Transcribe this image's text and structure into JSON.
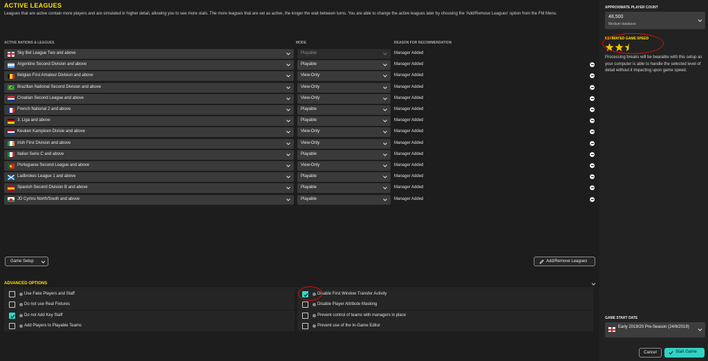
{
  "header": {
    "title": "ACTIVE LEAGUES",
    "intro": "Leagues that are active contain more players and are simulated in higher detail, allowing you to see more stats. The more leagues that are set as active, the longer the wait between turns. You are able to change the active leagues later by choosing the 'Add/Remove Leagues' option from the FM Menu."
  },
  "columns": {
    "nations": "ACTIVE NATIONS & LEAGUES",
    "mode": "MODE",
    "reason": "REASON FOR RECOMMENDATION"
  },
  "leagues": [
    {
      "name": "Sky Bet League Two and above",
      "mode": "Playable",
      "reason": "Manager Added",
      "flag": "england",
      "removable": false,
      "mode_dim": true
    },
    {
      "name": "Argentine Second Division and above",
      "mode": "Playable",
      "reason": "Manager Added",
      "flag": "argentina",
      "removable": true,
      "mode_dim": false
    },
    {
      "name": "Belgian First Amateur Division and above",
      "mode": "View-Only",
      "reason": "Manager Added",
      "flag": "belgium",
      "removable": true,
      "mode_dim": false
    },
    {
      "name": "Brazilian National Second Division and above",
      "mode": "View-Only",
      "reason": "Manager Added",
      "flag": "brazil",
      "removable": true,
      "mode_dim": false
    },
    {
      "name": "Croatian Second League and above",
      "mode": "View-Only",
      "reason": "Manager Added",
      "flag": "croatia",
      "removable": true,
      "mode_dim": false
    },
    {
      "name": "French National 2 and above",
      "mode": "Playable",
      "reason": "Manager Added",
      "flag": "france",
      "removable": true,
      "mode_dim": false
    },
    {
      "name": "3. Liga and above",
      "mode": "Playable",
      "reason": "Manager Added",
      "flag": "germany",
      "removable": true,
      "mode_dim": false
    },
    {
      "name": "Keuken Kampioen Divisie and above",
      "mode": "View-Only",
      "reason": "Manager Added",
      "flag": "netherlands",
      "removable": true,
      "mode_dim": false
    },
    {
      "name": "Irish First Division and above",
      "mode": "View-Only",
      "reason": "Manager Added",
      "flag": "ireland",
      "removable": true,
      "mode_dim": false
    },
    {
      "name": "Italian Serie C and above",
      "mode": "Playable",
      "reason": "Manager Added",
      "flag": "italy",
      "removable": true,
      "mode_dim": false
    },
    {
      "name": "Portuguese Second League and above",
      "mode": "View-Only",
      "reason": "Manager Added",
      "flag": "portugal",
      "removable": true,
      "mode_dim": false
    },
    {
      "name": "Ladbrokes League 1 and above",
      "mode": "Playable",
      "reason": "Manager Added",
      "flag": "scotland",
      "removable": true,
      "mode_dim": false
    },
    {
      "name": "Spanish Second Division B and above",
      "mode": "Playable",
      "reason": "Manager Added",
      "flag": "spain",
      "removable": true,
      "mode_dim": false
    },
    {
      "name": "JD Cymru North/South and above",
      "mode": "Playable",
      "reason": "Manager Added",
      "flag": "wales",
      "removable": true,
      "mode_dim": false
    }
  ],
  "buttons": {
    "game_setup": "Game Setup",
    "add_remove": "Add/Remove Leagues",
    "cancel": "Cancel",
    "start": "Start Game"
  },
  "advanced": {
    "title": "ADVANCED OPTIONS",
    "left": [
      {
        "label": "Use Fake Players and Staff",
        "checked": false
      },
      {
        "label": "Do not use Real Fixtures",
        "checked": false
      },
      {
        "label": "Do not Add Key Staff",
        "checked": true
      },
      {
        "label": "Add Players to Playable Teams",
        "checked": false
      }
    ],
    "right": [
      {
        "label": "Disable First Window Transfer Activity",
        "checked": true
      },
      {
        "label": "Disable Player Attribute Masking",
        "checked": false
      },
      {
        "label": "Prevent control of teams with managers in place",
        "checked": false
      },
      {
        "label": "Prevent use of the In-Game Editor",
        "checked": false
      }
    ]
  },
  "sidebar": {
    "player_count_label": "APPROXIMATE PLAYER COUNT",
    "player_count": "48,500",
    "database": "Medium database",
    "speed_label": "ESTIMATED GAME SPEED",
    "speed_stars": 2.5,
    "speed_max": 3,
    "speed_text": "Processing breaks will be bearable with this setup as your computer is able to handle the selected level of detail without it impacting upon game speed.",
    "start_date_label": "GAME START DATE",
    "start_date": "Early 2019/20 Pre-Season (24/6/2019)"
  },
  "colors": {
    "accent": "#ffe000",
    "primary_button": "#30d2c4",
    "checkbox": "#35d7c9",
    "annotation": "#d01010",
    "star": "#f5c400"
  }
}
